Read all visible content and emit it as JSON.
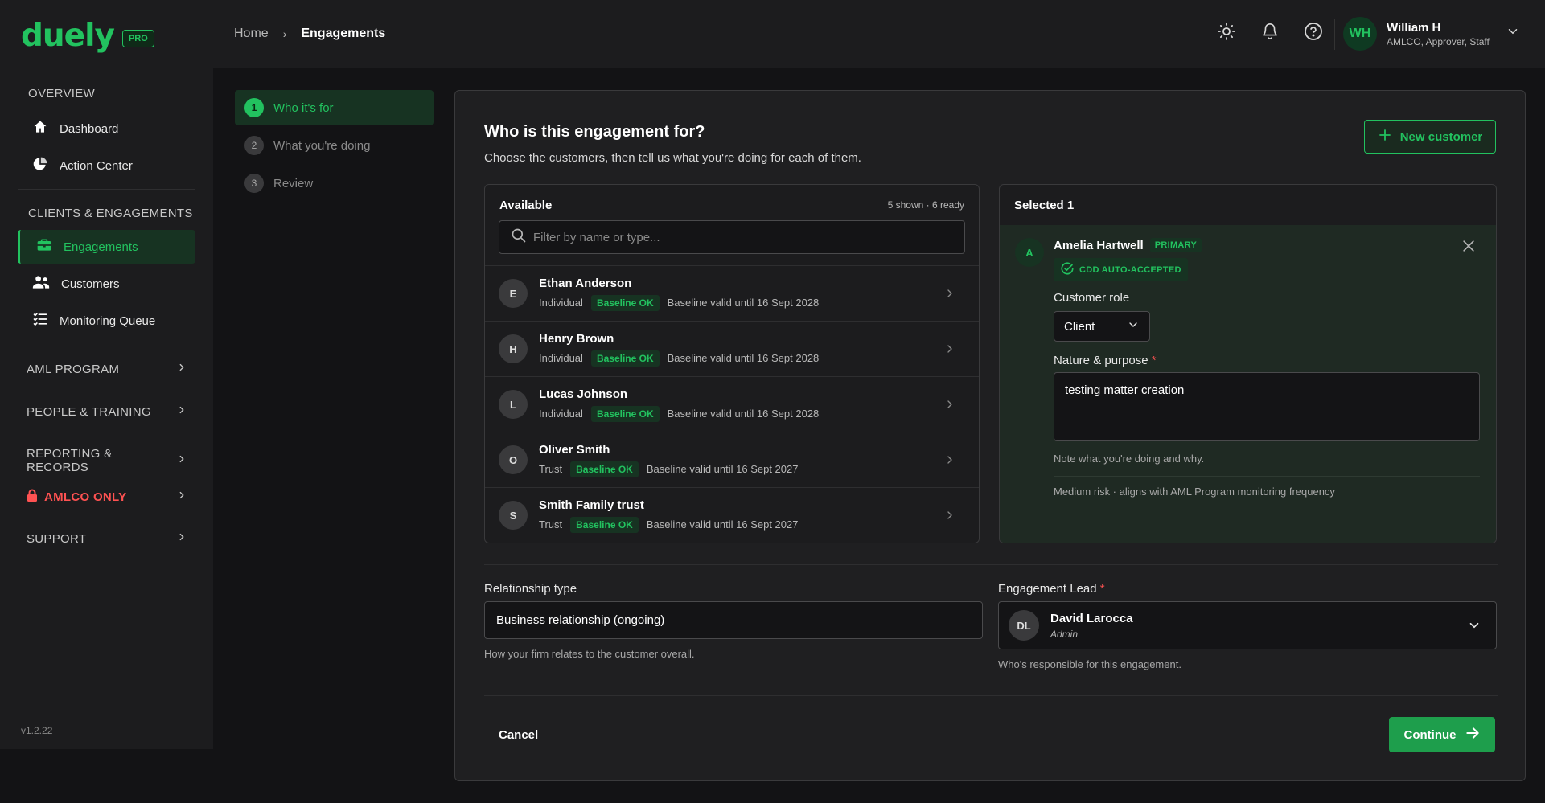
{
  "app": {
    "logo": "duely",
    "plan_badge": "PRO",
    "version": "v1.2.22"
  },
  "breadcrumb": {
    "home": "Home",
    "separator": "›",
    "current": "Engagements"
  },
  "topbar": {
    "icons": [
      "sun-icon",
      "bell-icon",
      "help-icon"
    ],
    "user": {
      "initials": "WH",
      "name": "William H",
      "role": "AMLCO, Approver, Staff"
    }
  },
  "sidebar": {
    "overview_label": "OVERVIEW",
    "dashboard": "Dashboard",
    "action_center": "Action Center",
    "clients_label": "CLIENTS & ENGAGEMENTS",
    "engagements": "Engagements",
    "customers": "Customers",
    "monitoring_queue": "Monitoring Queue",
    "groups": {
      "aml_program": "AML PROGRAM",
      "people_training": "PEOPLE & TRAINING",
      "reporting_records": "REPORTING & RECORDS",
      "amlco_only": "AMLCO ONLY",
      "support": "SUPPORT"
    }
  },
  "steps": [
    {
      "num": "1",
      "label": "Who it's for",
      "active": true
    },
    {
      "num": "2",
      "label": "What you're doing",
      "active": false
    },
    {
      "num": "3",
      "label": "Review",
      "active": false
    }
  ],
  "panel": {
    "title": "Who is this engagement for?",
    "subtitle": "Choose the customers, then tell us what you're doing for each of them.",
    "new_customer": "New customer"
  },
  "available": {
    "heading": "Available",
    "meta": "5 shown · 6 ready",
    "filter_placeholder": "Filter by name or type...",
    "rows": [
      {
        "initial": "E",
        "name": "Ethan Anderson",
        "type": "Individual",
        "badge": "Baseline OK",
        "valid": "Baseline valid until 16 Sept 2028"
      },
      {
        "initial": "H",
        "name": "Henry Brown",
        "type": "Individual",
        "badge": "Baseline OK",
        "valid": "Baseline valid until 16 Sept 2028"
      },
      {
        "initial": "L",
        "name": "Lucas Johnson",
        "type": "Individual",
        "badge": "Baseline OK",
        "valid": "Baseline valid until 16 Sept 2028"
      },
      {
        "initial": "O",
        "name": "Oliver Smith",
        "type": "Trust",
        "badge": "Baseline OK",
        "valid": "Baseline valid until 16 Sept 2027"
      },
      {
        "initial": "S",
        "name": "Smith Family trust",
        "type": "Trust",
        "badge": "Baseline OK",
        "valid": "Baseline valid until 16 Sept 2027"
      }
    ]
  },
  "selected": {
    "heading": "Selected 1",
    "initial": "A",
    "name": "Amelia Hartwell",
    "primary_badge": "PRIMARY",
    "cdd_badge": "CDD AUTO-ACCEPTED",
    "role_label": "Customer role",
    "role_value": "Client",
    "nature_label": "Nature & purpose",
    "required_mark": "*",
    "nature_value": "testing matter creation",
    "nature_hint": "Note what you're doing and why.",
    "risk_note": "Medium risk · aligns with AML Program monitoring frequency"
  },
  "relationship": {
    "label": "Relationship type",
    "value": "Business relationship (ongoing)",
    "hint": "How your firm relates to the customer overall."
  },
  "lead": {
    "label": "Engagement Lead",
    "required_mark": "*",
    "initials": "DL",
    "name": "David Larocca",
    "role": "Admin",
    "hint": "Who's responsible for this engagement."
  },
  "footer": {
    "cancel": "Cancel",
    "continue": "Continue"
  },
  "colors": {
    "accent": "#22c25f",
    "danger": "#ff5252",
    "background": "#131315",
    "surface": "#1c1c1e"
  }
}
